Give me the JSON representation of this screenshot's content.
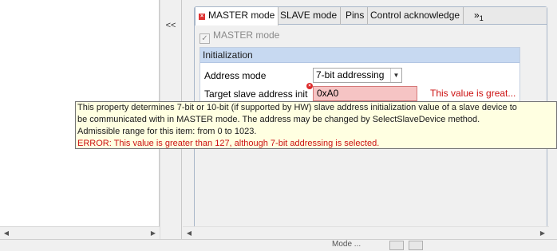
{
  "splitter": {
    "collapse_label": "<<"
  },
  "tabs": [
    {
      "label": "MASTER mode",
      "active": true,
      "has_error": true
    },
    {
      "label": "SLAVE mode"
    },
    {
      "label": "Pins"
    },
    {
      "label": "Control acknowledge"
    }
  ],
  "tab_overflow": {
    "symbol": "»",
    "count": "1"
  },
  "master_checkbox": {
    "label": "MASTER mode",
    "checked": true
  },
  "group": {
    "title": "Initialization",
    "address_mode": {
      "label": "Address mode",
      "value": "7-bit addressing"
    },
    "target_slave": {
      "label": "Target slave address init",
      "value": "0xA0",
      "error_inline": "This value is great..."
    }
  },
  "tooltip": {
    "line1": "This property determines 7-bit or 10-bit (if supported by HW) slave address initialization value of a slave device to",
    "line2": "be communicated with in MASTER mode. The address may be changed by SelectSlaveDevice method.",
    "line3": "Admissible range for this item: from 0 to 1023.",
    "error": "ERROR: This value is greater than 127, although 7-bit addressing is selected."
  },
  "bottom_partial": "Mode ...",
  "colors": {
    "error": "#cc1111",
    "tooltip_bg": "#ffffe1",
    "group_header": "#c7d9f1",
    "error_field": "#f6c4c4"
  },
  "icons": [
    "error-icon",
    "checkbox-checked-icon",
    "dropdown-arrow-icon",
    "scroll-left-icon",
    "scroll-right-icon"
  ]
}
